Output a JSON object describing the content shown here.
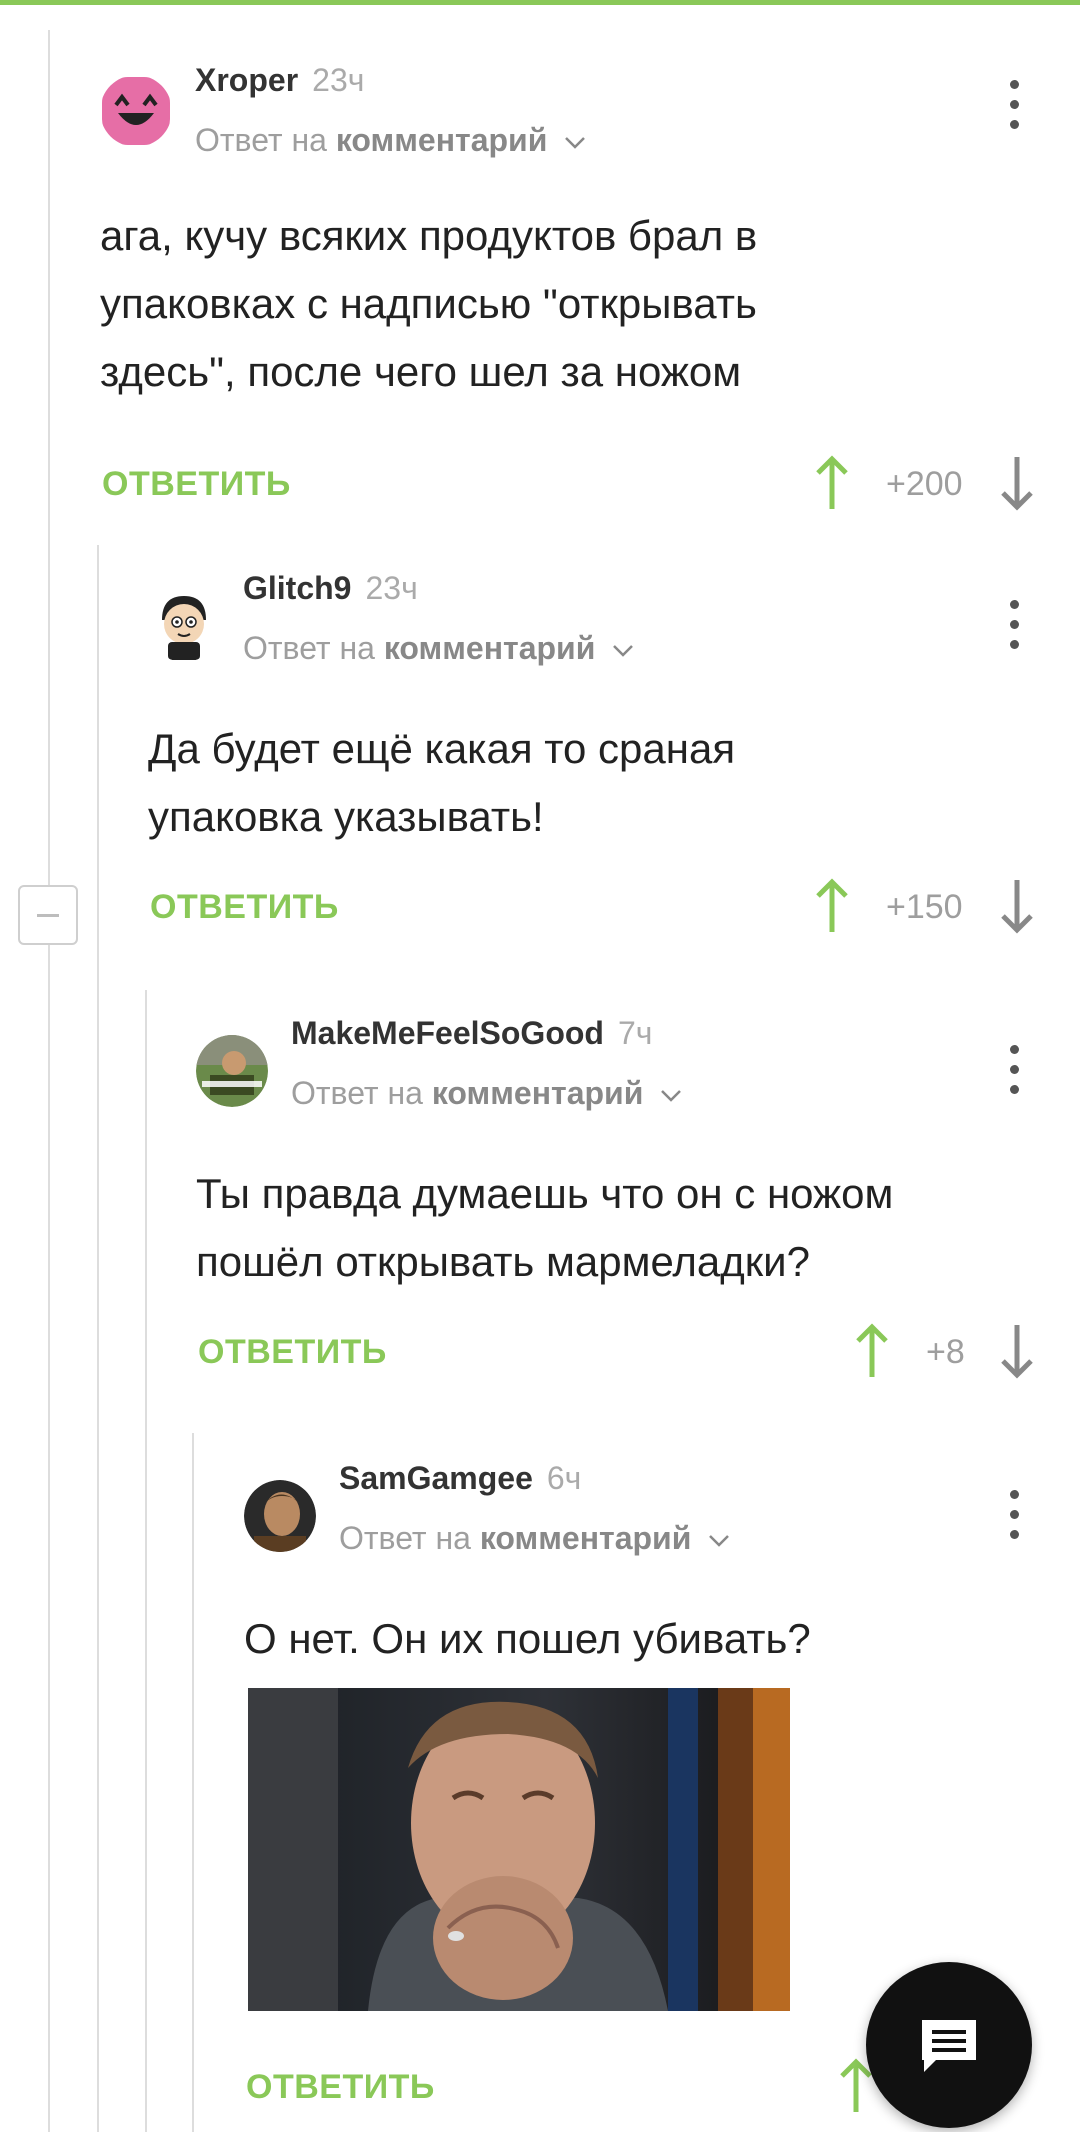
{
  "colors": {
    "accent": "#8ac858",
    "text": "#222222",
    "muted": "#9e9e9e"
  },
  "comments": [
    {
      "username": "Xroper",
      "time": "23ч",
      "reply_prefix": "Ответ на",
      "reply_target": "комментарий",
      "text_lines": [
        "ага, кучу всяких продуктов брал в",
        "упаковках с надписью \"открывать",
        "здесь\", после чего шел за ножом"
      ],
      "reply_label": "ОТВЕТИТЬ",
      "score": "+200",
      "avatar_icon": "pink-smiley-avatar"
    },
    {
      "username": "Glitch9",
      "time": "23ч",
      "reply_prefix": "Ответ на",
      "reply_target": "комментарий",
      "text_lines": [
        "Да будет ещё какая то сраная",
        "упаковка указывать!"
      ],
      "reply_label": "ОТВЕТИТЬ",
      "score": "+150",
      "avatar_icon": "cartoon-character-avatar"
    },
    {
      "username": "MakeMeFeelSoGood",
      "time": "7ч",
      "reply_prefix": "Ответ на",
      "reply_target": "комментарий",
      "text_lines": [
        "Ты правда думаешь что он с ножом",
        "пошёл открывать мармеладки?"
      ],
      "reply_label": "ОТВЕТИТЬ",
      "score": "+8",
      "avatar_icon": "meme-avatar"
    },
    {
      "username": "SamGamgee",
      "time": "6ч",
      "reply_prefix": "Ответ на",
      "reply_target": "комментарий",
      "text_lines": [
        "О нет. Он их пошел убивать?"
      ],
      "reply_label": "ОТВЕТИТЬ",
      "score": "",
      "avatar_icon": "hobbit-avatar"
    }
  ],
  "fab_icon": "comment-icon"
}
